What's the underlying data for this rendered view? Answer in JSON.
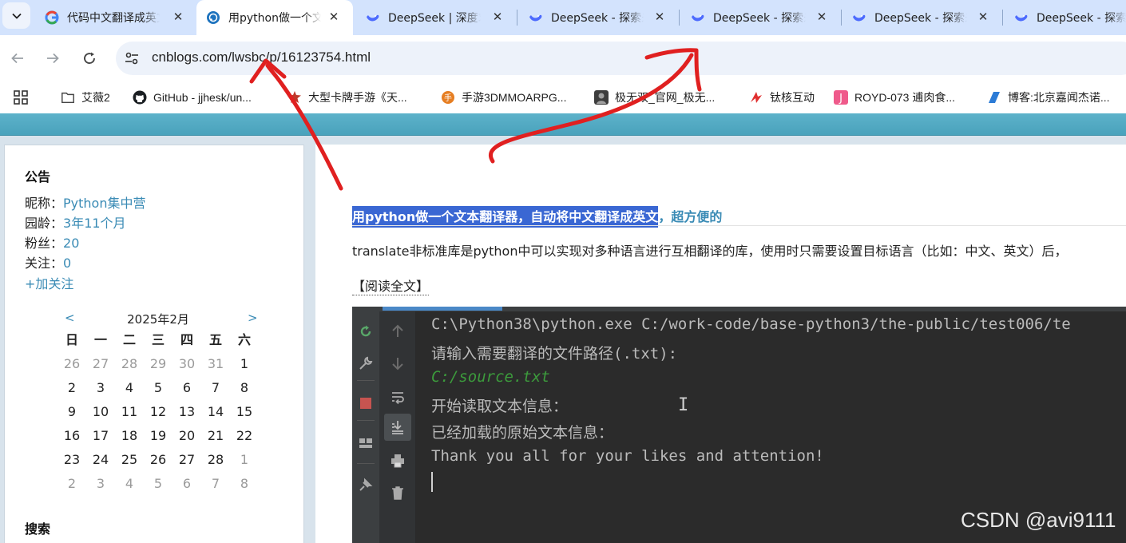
{
  "browser": {
    "tabs": [
      {
        "title": "代码中文翻译成英文",
        "favicon": "google-icon",
        "active": false
      },
      {
        "title": "用python做一个文本翻译器",
        "favicon": "cnblogs-icon",
        "active": true
      },
      {
        "title": "DeepSeek | 深度求索",
        "favicon": "deepseek-icon",
        "active": false
      },
      {
        "title": "DeepSeek - 探索未至之境",
        "favicon": "deepseek-icon",
        "active": false
      },
      {
        "title": "DeepSeek - 探索未至之境",
        "favicon": "deepseek-icon",
        "active": false
      },
      {
        "title": "DeepSeek - 探索未至之境",
        "favicon": "deepseek-icon",
        "active": false
      },
      {
        "title": "DeepSeek - 探索未至之境",
        "favicon": "deepseek-icon",
        "active": false
      }
    ],
    "close_glyph": "✕",
    "url": "cnblogs.com/lwsbc/p/16123754.html",
    "bookmarks": [
      {
        "label": "艾薇2",
        "icon": "folder-icon"
      },
      {
        "label": "GitHub - jjhesk/un...",
        "icon": "github-icon"
      },
      {
        "label": "大型卡牌手游《天...",
        "icon": "game-icon"
      },
      {
        "label": "手游3DMMOARPG...",
        "icon": "game-icon"
      },
      {
        "label": "极无双_官网_极无...",
        "icon": "game-icon"
      },
      {
        "label": "钛核互动",
        "icon": "titanium-icon"
      },
      {
        "label": "ROYD-073 逋肉食...",
        "icon": "j-icon"
      },
      {
        "label": "博客:北京嘉闻杰诺...",
        "icon": "blog-icon"
      }
    ]
  },
  "sidebar": {
    "notice_title": "公告",
    "profile": [
      {
        "label": "昵称：",
        "value": "Python集中营"
      },
      {
        "label": "园龄：",
        "value": "3年11个月"
      },
      {
        "label": "粉丝：",
        "value": "20"
      },
      {
        "label": "关注：",
        "value": "0"
      }
    ],
    "follow_label": "+加关注",
    "calendar": {
      "prev": "<",
      "next": ">",
      "month_label": "2025年2月",
      "weekdays": [
        "日",
        "一",
        "二",
        "三",
        "四",
        "五",
        "六"
      ],
      "weeks": [
        [
          "26",
          "27",
          "28",
          "29",
          "30",
          "31",
          "1"
        ],
        [
          "2",
          "3",
          "4",
          "5",
          "6",
          "7",
          "8"
        ],
        [
          "9",
          "10",
          "11",
          "12",
          "13",
          "14",
          "15"
        ],
        [
          "16",
          "17",
          "18",
          "19",
          "20",
          "21",
          "22"
        ],
        [
          "23",
          "24",
          "25",
          "26",
          "27",
          "28",
          "1"
        ],
        [
          "2",
          "3",
          "4",
          "5",
          "6",
          "7",
          "8"
        ]
      ]
    },
    "search_title": "搜索"
  },
  "post": {
    "title_highlighted": "用python做一个文本翻译器，自动将中文翻译成英文",
    "title_rest": "，超方便的",
    "description": "translate非标准库是python中可以实现对多种语言进行互相翻译的库，使用时只需要设置目标语言（比如：中文、英文）后，",
    "read_more": "【阅读全文】"
  },
  "console": {
    "lines": [
      "C:\\Python38\\python.exe C:/work-code/base-python3/the-public/test006/te",
      "请输入需要翻译的文件路径(.txt):",
      "C:/source.txt",
      "开始读取文本信息：",
      "已经加载的原始文本信息：",
      "Thank you all for your likes and attention!"
    ],
    "cursor_glyph": "I"
  },
  "watermark": "CSDN @avi9111",
  "colors": {
    "tabstrip": "#d3e3fd",
    "link": "#3a8bb5",
    "title_highlight": "#3a67d3",
    "header_band": "#4fa7c1",
    "console_bg": "#2b2b2b",
    "annotation": "#e02020"
  }
}
